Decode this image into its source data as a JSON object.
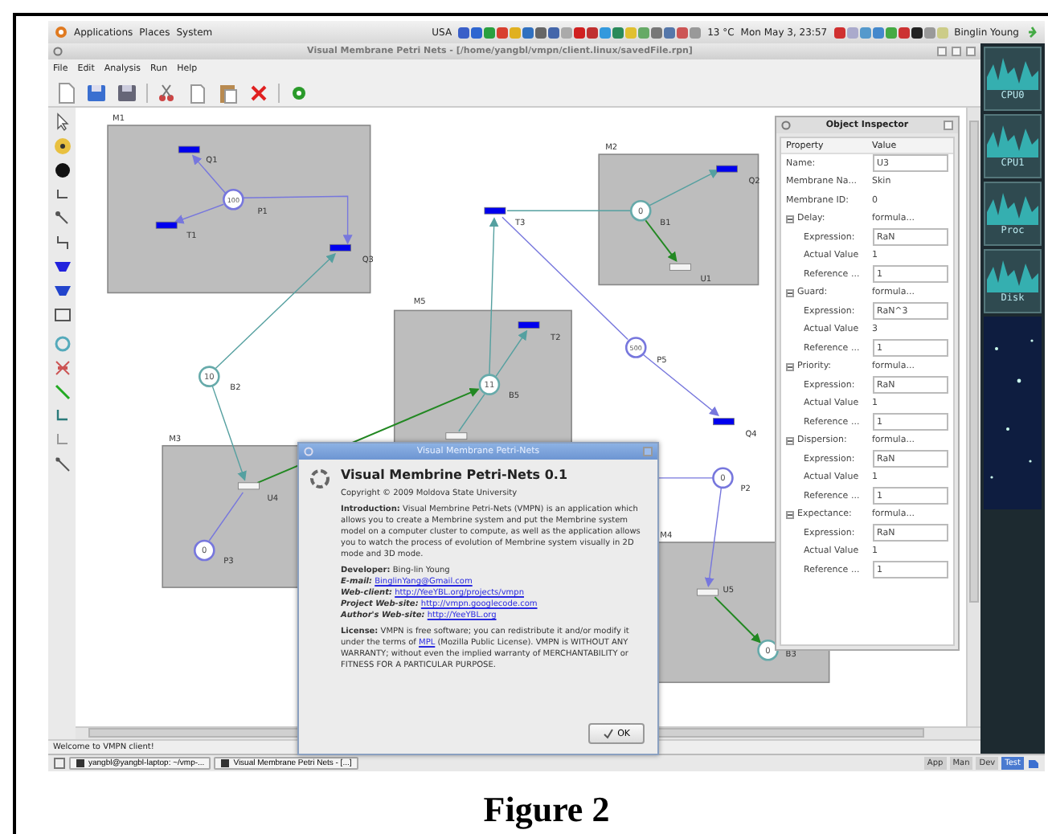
{
  "top_panel": {
    "menus": [
      "Applications",
      "Places",
      "System"
    ],
    "keyboard": "USA",
    "weather": "13 °C",
    "clock": "Mon May  3, 23:57",
    "user": "Binglin Young"
  },
  "window": {
    "title": "Visual Membrane Petri Nets - [/home/yangbl/vmpn/client.linux/savedFile.rpn]",
    "menu": [
      "File",
      "Edit",
      "Analysis",
      "Run",
      "Help"
    ]
  },
  "diagram": {
    "membranes": [
      {
        "label": "M1"
      },
      {
        "label": "M2"
      },
      {
        "label": "M5"
      },
      {
        "label": "M3"
      },
      {
        "label": "M4"
      }
    ],
    "places": [
      {
        "label": "P1",
        "tokens": "100",
        "color": "#7777dd"
      },
      {
        "label": "B1",
        "tokens": "0",
        "color": "#66aaaa"
      },
      {
        "label": "B2",
        "tokens": "10",
        "color": "#66aaaa"
      },
      {
        "label": "P5",
        "tokens": "500",
        "color": "#7777dd"
      },
      {
        "label": "B5",
        "tokens": "11",
        "color": "#66aaaa"
      },
      {
        "label": "P3",
        "tokens": "0",
        "color": "#7777dd"
      },
      {
        "label": "P2",
        "tokens": "0",
        "color": "#7777dd"
      },
      {
        "label": "B3",
        "tokens": "0",
        "color": "#66aaaa"
      }
    ],
    "transitions": [
      {
        "label": "Q1",
        "color": "#0000ee"
      },
      {
        "label": "T1",
        "color": "#0000ee"
      },
      {
        "label": "Q3",
        "color": "#0000ee"
      },
      {
        "label": "T3",
        "color": "#0000ee"
      },
      {
        "label": "Q2",
        "color": "#0000ee"
      },
      {
        "label": "U1",
        "color": "#f4f4f4"
      },
      {
        "label": "T2",
        "color": "#0000ee"
      },
      {
        "label": "Q4",
        "color": "#0000ee"
      },
      {
        "label": "U4",
        "color": "#f4f4f4"
      },
      {
        "label": "U5",
        "color": "#f4f4f4"
      },
      {
        "color": "#f4f4f4"
      }
    ]
  },
  "inspector": {
    "title": "Object Inspector",
    "columns": [
      "Property",
      "Value"
    ],
    "rows": [
      {
        "label": "Name:",
        "value": "U3",
        "kind": "field"
      },
      {
        "label": "Membrane Na...",
        "value": "Skin",
        "kind": "text"
      },
      {
        "label": "Membrane ID:",
        "value": "0",
        "kind": "text"
      },
      {
        "label": "Delay:",
        "value": "formula...",
        "kind": "text",
        "expanded": true,
        "children": [
          {
            "label": "Expression:",
            "value": "RaN",
            "kind": "field"
          },
          {
            "label": "Actual Value",
            "value": "1",
            "kind": "text"
          },
          {
            "label": "Reference ...",
            "value": "1",
            "kind": "field"
          }
        ]
      },
      {
        "label": "Guard:",
        "value": "formula...",
        "kind": "text",
        "expanded": true,
        "children": [
          {
            "label": "Expression:",
            "value": "RaN^3",
            "kind": "field"
          },
          {
            "label": "Actual Value",
            "value": "3",
            "kind": "text"
          },
          {
            "label": "Reference ...",
            "value": "1",
            "kind": "field"
          }
        ]
      },
      {
        "label": "Priority:",
        "value": "formula...",
        "kind": "text",
        "expanded": true,
        "children": [
          {
            "label": "Expression:",
            "value": "RaN",
            "kind": "field"
          },
          {
            "label": "Actual Value",
            "value": "1",
            "kind": "text"
          },
          {
            "label": "Reference ...",
            "value": "1",
            "kind": "field"
          }
        ]
      },
      {
        "label": "Dispersion:",
        "value": "formula...",
        "kind": "text",
        "expanded": true,
        "children": [
          {
            "label": "Expression:",
            "value": "RaN",
            "kind": "field"
          },
          {
            "label": "Actual Value",
            "value": "1",
            "kind": "text"
          },
          {
            "label": "Reference ...",
            "value": "1",
            "kind": "field"
          }
        ]
      },
      {
        "label": "Expectance:",
        "value": "formula...",
        "kind": "text",
        "expanded": true,
        "children": [
          {
            "label": "Expression:",
            "value": "RaN",
            "kind": "field"
          },
          {
            "label": "Actual Value",
            "value": "1",
            "kind": "text"
          },
          {
            "label": "Reference ...",
            "value": "1",
            "kind": "field"
          }
        ]
      }
    ]
  },
  "about": {
    "title": "Visual Membrane Petri-Nets",
    "heading": "Visual Membrine Petri-Nets 0.1",
    "copyright": "Copyright © 2009 Moldova State University",
    "intro": "**Introduction:** Visual Membrine Petri-Nets (VMPN) is an application which allows you to create a Membrine system and put the Membrine system model on a computer cluster to compute, as well as the application allows you to watch the process of evolution of Membrine system visually in 2D mode and 3D mode.",
    "credits": [
      {
        "label": "Developer:",
        "text": "Bing-lin Young"
      },
      {
        "label": "E-mail:",
        "link": "BinglinYang@Gmail.com"
      },
      {
        "label": "Web-client:",
        "link": "http://YeeYBL.org/projects/vmpn"
      },
      {
        "label": "Project Web-site:",
        "link": "http://vmpn.googlecode.com"
      },
      {
        "label": "Author's Web-site:",
        "link": "http://YeeYBL.org"
      }
    ],
    "license": {
      "before": "**License:** VMPN is free software; you can redistribute it and/or modify it under the terms of",
      "link": "MPL",
      "after": "(Mozilla Public License). VMPN is WITHOUT ANY WARRANTY; without even the implied warranty of MERCHANTABILITY or FITNESS FOR A PARTICULAR PURPOSE."
    },
    "ok": "OK"
  },
  "status_bar": "Welcome to VMPN client!",
  "taskbar": {
    "tasks": [
      "yangbl@yangbl-laptop: ~/vmp-...",
      "Visual Membrane Petri Nets - [...]"
    ],
    "workspaces": [
      {
        "label": "App",
        "selected": false
      },
      {
        "label": "Man",
        "selected": false
      },
      {
        "label": "Dev",
        "selected": false
      },
      {
        "label": "Test",
        "selected": true
      }
    ]
  },
  "monitor": {
    "labels": [
      "CPU0",
      "CPU1",
      "Proc",
      "Disk"
    ]
  },
  "caption": "Figure 2"
}
